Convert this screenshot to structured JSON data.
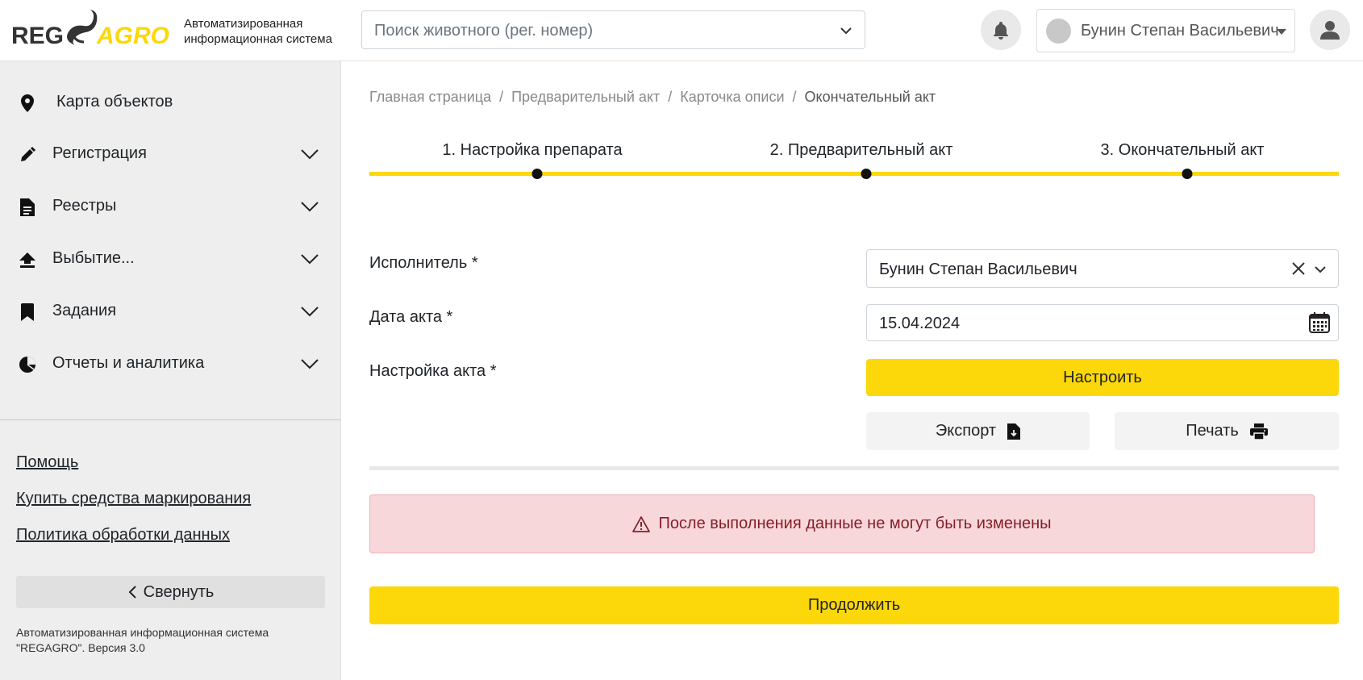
{
  "header": {
    "logo_left": "REG",
    "logo_right": "AGRO",
    "subtitle_line1": "Автоматизированная",
    "subtitle_line2": "информационная система",
    "search_placeholder": "Поиск животного (рег. номер)",
    "user_name": "Бунин Степан Васильевич",
    "icons": {
      "notifications": "bell-icon",
      "profile": "user-icon"
    }
  },
  "sidebar": {
    "items": [
      {
        "label": "Карта объектов",
        "icon": "map-pin-icon",
        "expandable": false
      },
      {
        "label": "Регистрация",
        "icon": "pencil-icon",
        "expandable": true
      },
      {
        "label": "Реестры",
        "icon": "document-icon",
        "expandable": true
      },
      {
        "label": "Выбытие...",
        "icon": "upload-arrow-icon",
        "expandable": true
      },
      {
        "label": "Задания",
        "icon": "bookmark-icon",
        "expandable": true
      },
      {
        "label": "Отчеты и аналитика",
        "icon": "pie-chart-icon",
        "expandable": true
      }
    ],
    "links": [
      "Помощь",
      "Купить средства маркирования",
      "Политика обработки данных"
    ],
    "collapse_label": "Свернуть",
    "footer_line1": "Автоматизированная информационная система",
    "footer_line2": "\"REGAGRO\". Версия 3.0"
  },
  "breadcrumb": [
    "Главная страница",
    "Предварительный акт",
    "Карточка описи",
    "Окончательный акт"
  ],
  "steps": [
    "1. Настройка препарата",
    "2. Предварительный акт",
    "3. Окончательный акт"
  ],
  "form": {
    "executor_label": "Исполнитель *",
    "executor_value": "Бунин Степан Васильевич",
    "date_label": "Дата акта *",
    "date_value": "15.04.2024",
    "settings_label": "Настройка акта *",
    "configure_button": "Настроить",
    "export_button": "Экспорт",
    "print_button": "Печать"
  },
  "alert": {
    "text": "После выполнения данные не могут быть изменены",
    "icon": "warning-icon"
  },
  "continue_button": "Продолжить",
  "colors": {
    "accent": "#fcd80a",
    "sidebar_bg": "#eeeeee",
    "alert_bg": "#f8d7da",
    "alert_text": "#842029"
  }
}
